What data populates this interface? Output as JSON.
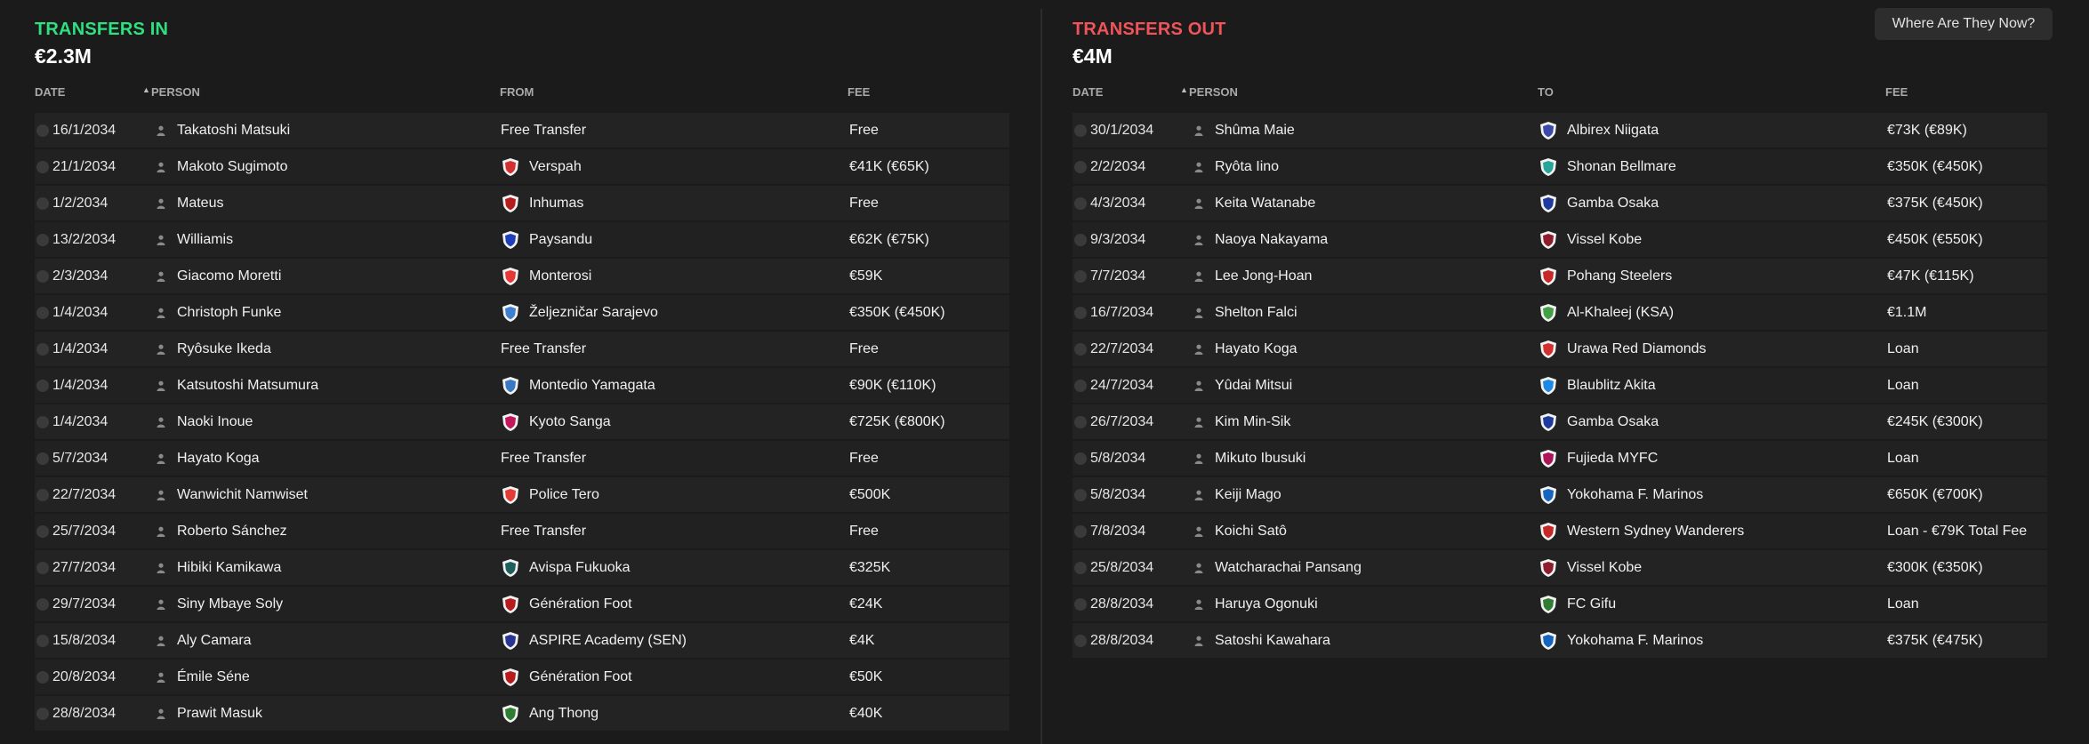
{
  "transfers_in": {
    "title": "TRANSFERS IN",
    "title_color": "#2ee07f",
    "total": "€2.3M",
    "headers": {
      "date": "DATE",
      "person": "PERSON",
      "club": "FROM",
      "fee": "FEE"
    },
    "rows": [
      {
        "date": "16/1/2034",
        "person": "Takatoshi Matsuki",
        "club": "Free Transfer",
        "fee": "Free",
        "crest": null
      },
      {
        "date": "21/1/2034",
        "person": "Makoto Sugimoto",
        "club": "Verspah",
        "fee": "€41K (€65K)",
        "crest": "#d32f2f"
      },
      {
        "date": "1/2/2034",
        "person": "Mateus",
        "club": "Inhumas",
        "fee": "Free",
        "crest": "#b71c1c"
      },
      {
        "date": "13/2/2034",
        "person": "Williamis",
        "club": "Paysandu",
        "fee": "€62K (€75K)",
        "crest": "#1e3fb8"
      },
      {
        "date": "2/3/2034",
        "person": "Giacomo Moretti",
        "club": "Monterosi",
        "fee": "€59K",
        "crest": "#e53935"
      },
      {
        "date": "1/4/2034",
        "person": "Christoph Funke",
        "club": "Željezničar Sarajevo",
        "fee": "€350K (€450K)",
        "crest": "#3f7fd0"
      },
      {
        "date": "1/4/2034",
        "person": "Ryôsuke Ikeda",
        "club": "Free Transfer",
        "fee": "Free",
        "crest": null
      },
      {
        "date": "1/4/2034",
        "person": "Katsutoshi Matsumura",
        "club": "Montedio Yamagata",
        "fee": "€90K (€110K)",
        "crest": "#3b78c4"
      },
      {
        "date": "1/4/2034",
        "person": "Naoki Inoue",
        "club": "Kyoto Sanga",
        "fee": "€725K (€800K)",
        "crest": "#c2185b"
      },
      {
        "date": "5/7/2034",
        "person": "Hayato Koga",
        "club": "Free Transfer",
        "fee": "Free",
        "crest": null
      },
      {
        "date": "22/7/2034",
        "person": "Wanwichit Namwiset",
        "club": "Police Tero",
        "fee": "€500K",
        "crest": "#e53935"
      },
      {
        "date": "25/7/2034",
        "person": "Roberto Sánchez",
        "club": "Free Transfer",
        "fee": "Free",
        "crest": null
      },
      {
        "date": "27/7/2034",
        "person": "Hibiki Kamikawa",
        "club": "Avispa Fukuoka",
        "fee": "€325K",
        "crest": "#1f5f5b"
      },
      {
        "date": "29/7/2034",
        "person": "Siny Mbaye Soly",
        "club": "Génération Foot",
        "fee": "€24K",
        "crest": "#b71c1c"
      },
      {
        "date": "15/8/2034",
        "person": "Aly Camara",
        "club": "ASPIRE Academy (SEN)",
        "fee": "€4K",
        "crest": "#283593"
      },
      {
        "date": "20/8/2034",
        "person": "Émile Séne",
        "club": "Génération Foot",
        "fee": "€50K",
        "crest": "#b71c1c"
      },
      {
        "date": "28/8/2034",
        "person": "Prawit Masuk",
        "club": "Ang Thong",
        "fee": "€40K",
        "crest": "#2e7d32"
      }
    ]
  },
  "transfers_out": {
    "title": "TRANSFERS OUT",
    "title_color": "#f0545a",
    "total": "€4M",
    "headers": {
      "date": "DATE",
      "person": "PERSON",
      "club": "TO",
      "fee": "FEE"
    },
    "rows": [
      {
        "date": "30/1/2034",
        "person": "Shûma Maie",
        "club": "Albirex Niigata",
        "fee": "€73K (€89K)",
        "crest": "#3b4aa8"
      },
      {
        "date": "2/2/2034",
        "person": "Ryôta Iino",
        "club": "Shonan Bellmare",
        "fee": "€350K (€450K)",
        "crest": "#26a69a"
      },
      {
        "date": "4/3/2034",
        "person": "Keita Watanabe",
        "club": "Gamba Osaka",
        "fee": "€375K (€450K)",
        "crest": "#1e3a9e"
      },
      {
        "date": "9/3/2034",
        "person": "Naoya Nakayama",
        "club": "Vissel Kobe",
        "fee": "€450K (€550K)",
        "crest": "#8e1c2c"
      },
      {
        "date": "7/7/2034",
        "person": "Lee Jong-Hoan",
        "club": "Pohang Steelers",
        "fee": "€47K (€115K)",
        "crest": "#c62828"
      },
      {
        "date": "16/7/2034",
        "person": "Shelton Falci",
        "club": "Al-Khaleej (KSA)",
        "fee": "€1.1M",
        "crest": "#43a047"
      },
      {
        "date": "22/7/2034",
        "person": "Hayato Koga",
        "club": "Urawa Red Diamonds",
        "fee": "Loan",
        "crest": "#d32f2f"
      },
      {
        "date": "24/7/2034",
        "person": "Yûdai Mitsui",
        "club": "Blaublitz Akita",
        "fee": "Loan",
        "crest": "#1e88e5"
      },
      {
        "date": "26/7/2034",
        "person": "Kim Min-Sik",
        "club": "Gamba Osaka",
        "fee": "€245K (€300K)",
        "crest": "#1e3a9e"
      },
      {
        "date": "5/8/2034",
        "person": "Mikuto Ibusuki",
        "club": "Fujieda MYFC",
        "fee": "Loan",
        "crest": "#ad1457"
      },
      {
        "date": "5/8/2034",
        "person": "Keiji Mago",
        "club": "Yokohama F. Marinos",
        "fee": "€650K (€700K)",
        "crest": "#1565c0"
      },
      {
        "date": "7/8/2034",
        "person": "Koichi Satô",
        "club": "Western Sydney Wanderers",
        "fee": "Loan - €79K Total Fee",
        "crest": "#c62828"
      },
      {
        "date": "25/8/2034",
        "person": "Watcharachai Pansang",
        "club": "Vissel Kobe",
        "fee": "€300K (€350K)",
        "crest": "#8e1c2c"
      },
      {
        "date": "28/8/2034",
        "person": "Haruya Ogonuki",
        "club": "FC Gifu",
        "fee": "Loan",
        "crest": "#2e7d32"
      },
      {
        "date": "28/8/2034",
        "person": "Satoshi Kawahara",
        "club": "Yokohama F. Marinos",
        "fee": "€375K (€475K)",
        "crest": "#1565c0"
      }
    ]
  },
  "where_button_label": "Where Are They Now?"
}
